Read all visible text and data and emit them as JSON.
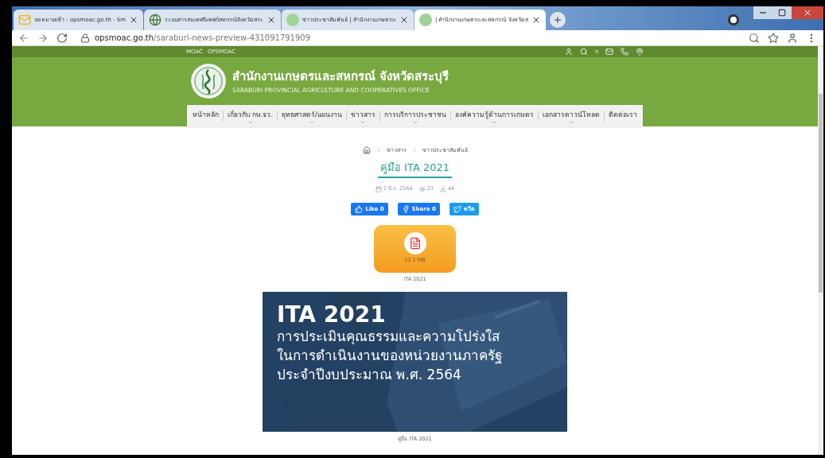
{
  "tabs": [
    {
      "title": "จดหมายเข้า - opsmoac.go.th - Sm",
      "selected": false
    },
    {
      "title": "ระบบสารสนเทศนิเทศก์สหกรณ์จังหวัดสระ",
      "selected": false
    },
    {
      "title": "ข่าวประชาสัมพันธ์ | สำนักงานเกษตรแ",
      "selected": false
    },
    {
      "title": "| สำนักงานเกษตรและสหกรณ์ จังหวัดส",
      "selected": true
    }
  ],
  "address_bar": {
    "domain": "opsmoac.go.th",
    "path": "/saraburi-news-preview-431091791909"
  },
  "top_links": [
    "MOAC",
    "OPSMOAC"
  ],
  "font_toggle": "ก",
  "site": {
    "title": "สำนักงานเกษตรและสหกรณ์ จังหวัดสระบุรี",
    "subtitle": "SARABURI PROVINCIAL AGRICULTURE AND COOPERATIVES OFFICE"
  },
  "nav": [
    {
      "label": "หน้าหลัก",
      "dropdown": false
    },
    {
      "label": "เกี่ยวกับ กษ.จว.",
      "dropdown": true
    },
    {
      "label": "ยุทธศาสตร์/แผนงาน",
      "dropdown": true
    },
    {
      "label": "ข่าวสาร",
      "dropdown": true
    },
    {
      "label": "การบริการประชาชน",
      "dropdown": true
    },
    {
      "label": "องค์ความรู้ด้านการเกษตร",
      "dropdown": true
    },
    {
      "label": "เอกสารดาวน์โหลด",
      "dropdown": true
    },
    {
      "label": "ติดต่อเรา",
      "dropdown": false
    }
  ],
  "breadcrumb": [
    "ข่าวสาร",
    "ข่าวประชาสัมพันธ์"
  ],
  "article": {
    "title": "คู่มือ ITA 2021",
    "date": "2 มิ.ย. 2564",
    "views": "23",
    "downloads": "44"
  },
  "share_buttons": [
    {
      "kind": "like",
      "label": "Like 0"
    },
    {
      "kind": "share",
      "label": "Share 0"
    },
    {
      "kind": "tweet",
      "label": "ทวีต"
    }
  ],
  "attachment": {
    "size": "12.1 MB",
    "name": "ITA 2021"
  },
  "banner": {
    "heading": "ITA 2021",
    "lines": [
      "การประเมินคุณธรรมและความโปร่งใส",
      "ในการดำเนินงานของหน่วยงานภาครัฐ",
      "ประจำปีงบประมาณ พ.ศ. 2564"
    ],
    "caption": "คู่มือ ITA 2021"
  }
}
